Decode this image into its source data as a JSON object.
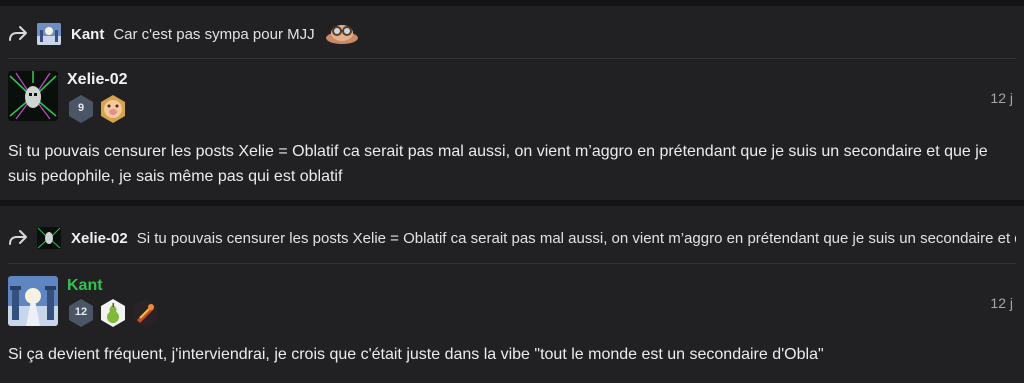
{
  "posts": [
    {
      "reply": {
        "author": "Kant",
        "text": "Car c'est pas sympa pour MJJ",
        "emoji_icon": "goggles-emoji-icon"
      },
      "author": "Xelie-02",
      "level": "9",
      "timestamp": "12 j",
      "body": "Si tu pouvais censurer les posts Xelie = Oblatif ca serait pas mal  aussi, on vient m’aggro en prétendant que je suis un secondaire et que je suis pedophile, je sais même pas qui est oblatif"
    },
    {
      "reply": {
        "author": "Xelie-02",
        "text": "Si tu pouvais censurer les posts Xelie = Oblatif ca serait pas mal  aussi, on vient m’aggro en prétendant que je suis un secondaire et que je suis pedophile, je sais même pas qui est oblatif"
      },
      "author": "Kant",
      "author_color": "#2ec44e",
      "level": "12",
      "timestamp": "12 j",
      "body": "Si ça devient fréquent, j'interviendrai, je crois que c'était juste dans la vibe \"tout le monde est un secondaire d'Obla\""
    }
  ]
}
